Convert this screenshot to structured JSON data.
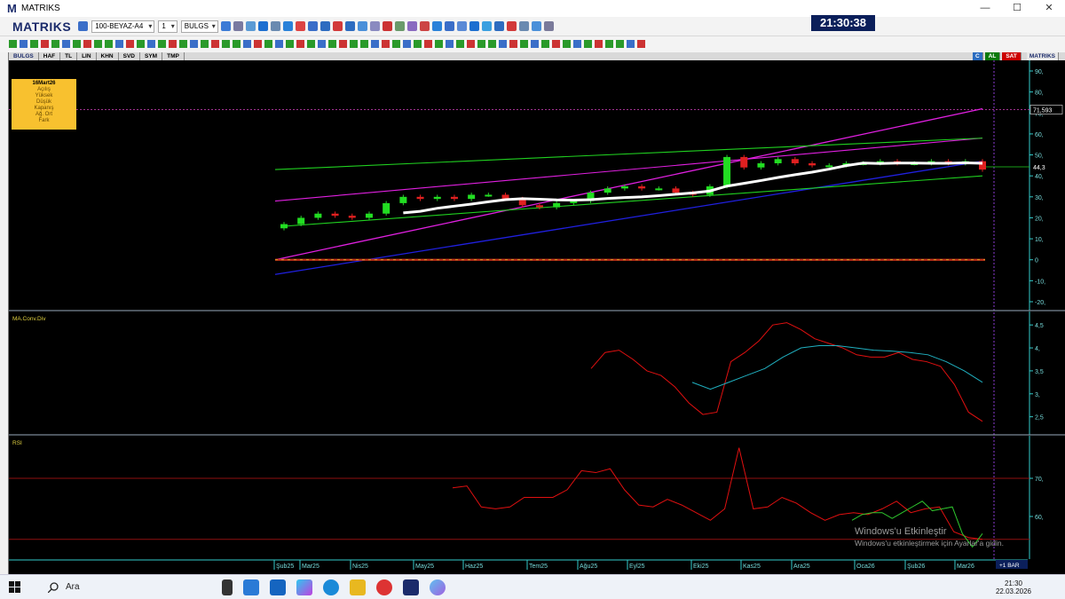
{
  "window": {
    "title": "MATRIKS",
    "minimize": "—",
    "maximize": "☐",
    "close": "✕"
  },
  "toolbar": {
    "brand": "MATRIKS",
    "template_select": "100-BEYAZ-A4",
    "period_select": "1",
    "symbol_select": "BULGS",
    "clock": "21:30:38"
  },
  "chart_header": {
    "symbol": "BULGS",
    "tabs": [
      "HAF",
      "TL",
      "LIN",
      "KHN",
      "SVD",
      "SYM",
      "TMP"
    ],
    "buy_label": "AL",
    "sell_label": "SAT",
    "brand": "MATRIKS",
    "c_label": "C"
  },
  "info_box": {
    "date": "16Mart26",
    "rows": [
      "Açılış",
      "Yüksek",
      "Düşük",
      "Kapanış",
      "Ağ. Ort",
      "Fark"
    ]
  },
  "panels": {
    "macd_label": "MA.Conv.Div",
    "rsi_label": "RSI",
    "bar_label": "+1 BAR"
  },
  "chart_data": [
    {
      "type": "candlestick",
      "y_ticks": [
        "90,",
        "80,",
        "70,",
        "60,",
        "50,",
        "40,",
        "30,",
        "20,",
        "10,",
        "0",
        "-10,",
        "-20,"
      ],
      "price_marker": "71,593",
      "last_price": "44,3",
      "ylim": [
        -20,
        90
      ],
      "x_labels": [
        "Şub25",
        "Mar25",
        "Nis25",
        "May25",
        "Haz25",
        "Tem25",
        "Ağu25",
        "Eyl25",
        "Eki25",
        "Kas25",
        "Ara25",
        "Oca26",
        "Şub26",
        "Mar26"
      ],
      "series": [
        {
          "values": [
            17,
            20,
            22,
            21,
            20,
            22,
            27,
            30,
            29,
            30,
            29,
            31,
            31,
            29,
            26,
            25,
            27,
            28,
            32,
            34,
            35,
            34,
            34,
            32,
            31,
            35,
            49,
            44,
            46,
            48,
            46,
            45,
            45,
            46,
            46,
            47,
            46,
            46,
            47,
            46,
            47,
            43
          ]
        }
      ]
    },
    {
      "type": "line",
      "y_ticks": [
        "4,5",
        "4,",
        "3,5",
        "3,",
        "2,5"
      ],
      "ylim": [
        2.3,
        4.6
      ],
      "series": [
        {
          "color": "#e01010",
          "values": [
            3.55,
            3.9,
            3.95,
            3.75,
            3.5,
            3.4,
            3.15,
            2.8,
            2.55,
            2.6,
            3.7,
            3.9,
            4.15,
            4.5,
            4.55,
            4.4,
            4.2,
            4.1,
            4.0,
            3.85,
            3.8,
            3.8,
            3.9,
            3.75,
            3.7,
            3.6,
            3.2,
            2.6,
            2.4
          ]
        },
        {
          "color": "#20b0c0",
          "values": [
            3.25,
            3.1,
            3.25,
            3.4,
            3.55,
            3.8,
            4.0,
            4.05,
            4.05,
            4.0,
            3.95,
            3.93,
            3.9,
            3.85,
            3.7,
            3.5,
            3.25
          ]
        }
      ]
    },
    {
      "type": "line",
      "y_ticks": [
        "70,",
        "60,"
      ],
      "ylim": [
        50,
        80
      ],
      "series": [
        {
          "color": "#e01010",
          "values": [
            67.5,
            68,
            62.5,
            62,
            62.5,
            65,
            65,
            65,
            67,
            72,
            71.5,
            72.5,
            67,
            63,
            62.5,
            64.5,
            63,
            61,
            59,
            62,
            78,
            62,
            62.5,
            65,
            63.5,
            61,
            59,
            60.5,
            61,
            60.5,
            62,
            64,
            61,
            62,
            62.5,
            56,
            54.5,
            54
          ]
        },
        {
          "color": "#2ec82e",
          "values": [
            59,
            60.5,
            61,
            61,
            59.5,
            61,
            62.5,
            64,
            61.5,
            62,
            62.5,
            55.5,
            52,
            55.5
          ]
        }
      ]
    }
  ],
  "watermark": {
    "title": "Windows'u Etkinleştir",
    "subtitle": "Windows'u etkinleştirmek için Ayarlar'a gidin."
  },
  "taskbar": {
    "search_placeholder": "Ara",
    "time": "21:30",
    "date": "22.03.2026"
  }
}
